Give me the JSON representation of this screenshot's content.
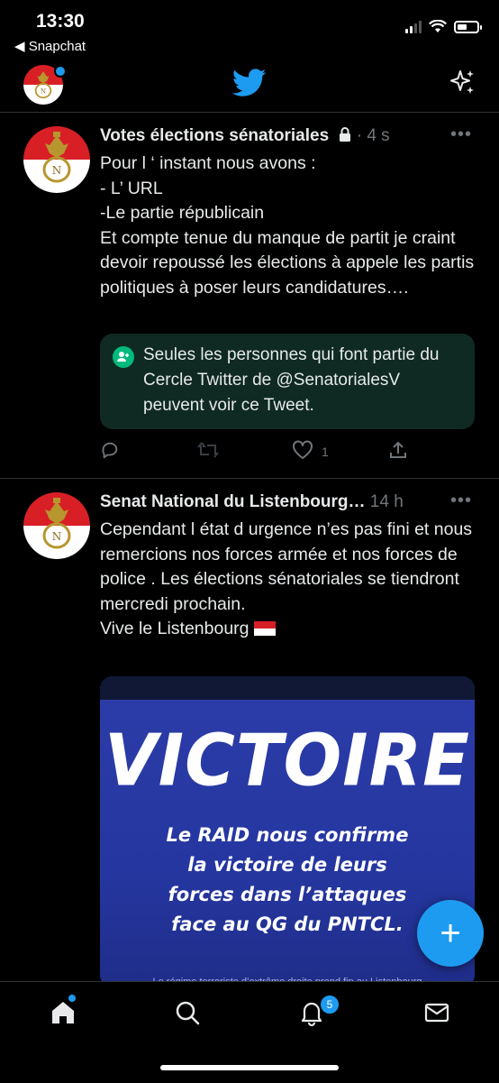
{
  "status": {
    "time": "13:30",
    "back_app": "◀ Snapchat"
  },
  "colors": {
    "accent": "#1d9bf0",
    "circle_bg": "#0f2a22",
    "circle_icon": "#00ba7c",
    "avatar_red": "#d81f26"
  },
  "tweets": [
    {
      "name": "Votes élections sénatoriales",
      "meta": " · 4 s",
      "body": "Pour l ‘ instant nous avons :\n- L’ URL\n-Le partie républicain\nEt compte tenue du manque de partit je craint devoir repoussé les élections à appele les partis politiques à poser leurs candidatures….",
      "circle_notice": "Seules les personnes qui font partie du Cercle Twitter de @SenatorialesV peuvent voir ce Tweet.",
      "like_count": "1"
    },
    {
      "name": "Senat National du Listenbourg…",
      "meta": " 14 h",
      "body": "Cependant l état d urgence n’es pas fini et nous remercions nos forces armée et nos forces de police . Les élections sénatoriales se tiendront mercredi prochain.\nVive le Listenbourg",
      "media": {
        "headline": "VICTOIRE",
        "subtext": "Le RAID nous confirme la victoire de leurs forces dans l’attaques face au QG du PNTCL.",
        "footer": "Le régime terroriste d’extrême droite prend fin au Listenbourg"
      }
    }
  ],
  "fab_label": "+",
  "tabbar": {
    "notifications_badge": "5"
  }
}
